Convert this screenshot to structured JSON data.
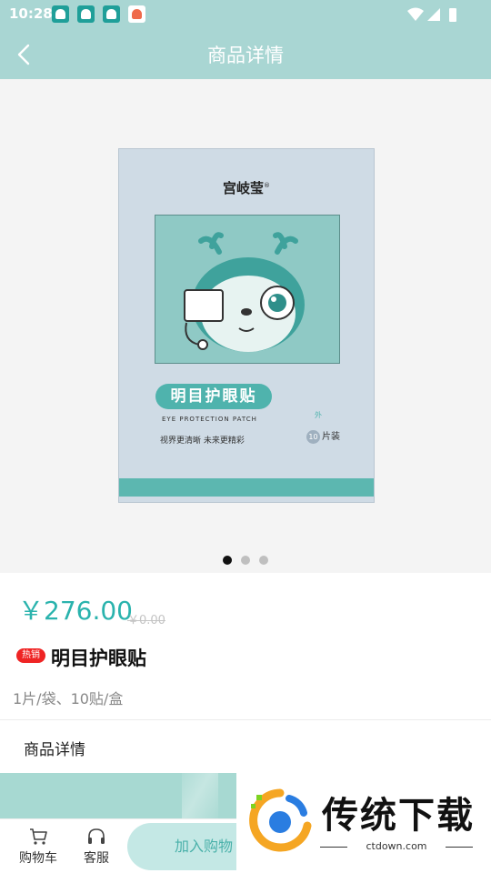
{
  "status_bar": {
    "time": "10:28",
    "notification_icons": [
      "app-notification-icon",
      "app-notification-icon",
      "app-notification-icon",
      "heart-app-icon"
    ],
    "system_icons": [
      "wifi-icon",
      "cellular-signal-icon",
      "battery-icon"
    ]
  },
  "header": {
    "title": "商品详情",
    "back_icon": "chevron-left-icon",
    "background_color": "#a9d6d3"
  },
  "product_image": {
    "brand": "宫岐莹",
    "registered_mark": "®",
    "product_name_on_box": "明目护眼贴",
    "english_name": "EYE PROTECTION PATCH",
    "slogan": "视界更清晰  未来更精彩",
    "external_use_mark": "外",
    "pack_count": "10",
    "pack_unit": "片装"
  },
  "carousel": {
    "total_pages": 3,
    "active_page": 1
  },
  "product": {
    "price": "￥276.00",
    "original_price": "￥0.00",
    "hot_tag": "热销",
    "name": "明目护眼贴",
    "spec": "1片/袋、10贴/盒"
  },
  "detail_section": {
    "title": "商品详情"
  },
  "bottom_bar": {
    "cart_label": "购物车",
    "cart_icon": "shopping-cart-icon",
    "service_label": "客服",
    "service_icon": "headphones-icon",
    "add_to_cart_label": "加入购物"
  },
  "watermark": {
    "text": "传统下载",
    "url": "ctdown.com"
  },
  "colors": {
    "accent": "#2ab3ad",
    "hot_tag": "#ef2424",
    "add_to_cart_bg": "#c4e8e5"
  }
}
